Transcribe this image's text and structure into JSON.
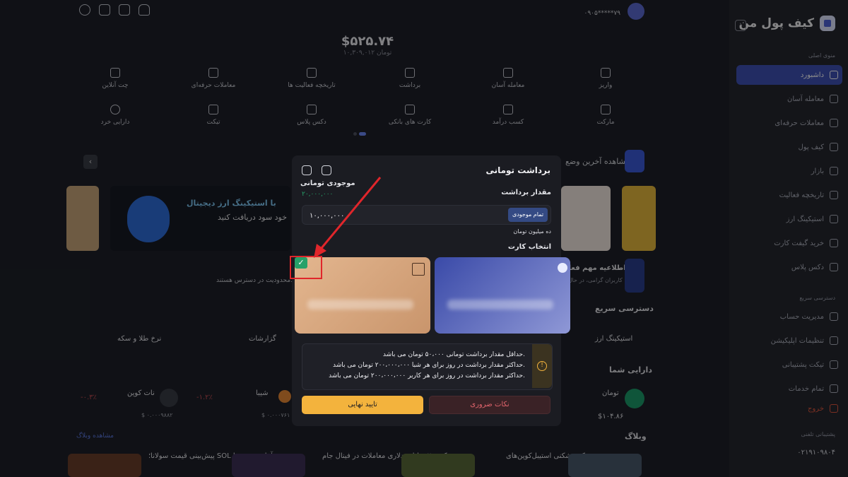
{
  "sidebar": {
    "logo": "کیف پول من",
    "section_main": "منوی اصلی",
    "items": [
      {
        "label": "داشبورد"
      },
      {
        "label": "معامله آسان"
      },
      {
        "label": "معاملات حرفه‌ای"
      },
      {
        "label": "کیف پول"
      },
      {
        "label": "بازار"
      },
      {
        "label": "تاریخچه فعالیت"
      },
      {
        "label": "استیکینگ ارز"
      },
      {
        "label": "خرید گیفت کارت"
      },
      {
        "label": "دکس پلاس"
      }
    ],
    "section_quick": "دسترسی سریع",
    "quick_items": [
      {
        "label": "مدیریت حساب"
      },
      {
        "label": "تنظیمات اپلیکیشن"
      },
      {
        "label": "تیکت پشتیبانی"
      },
      {
        "label": "تمام خدمات"
      },
      {
        "label": "خروج"
      }
    ],
    "support_label": "پشتیبانی تلفنی",
    "support_phone": "۰۲۱۹۱۰۹۸۰۴"
  },
  "header": {
    "phone": "۰۹۰۵*****۷۹",
    "balance_usd": "$۵۲۵.۷۴",
    "balance_irt": "۱۰,۳۰۹,۰۱۲ تومان"
  },
  "quick_actions": [
    {
      "label": "واریز"
    },
    {
      "label": "معامله آسان"
    },
    {
      "label": "برداشت"
    },
    {
      "label": "تاریخچه فعالیت ها"
    },
    {
      "label": "معاملات حرفه‌ای"
    },
    {
      "label": "چت آنلاین"
    },
    {
      "label": "مارکت"
    },
    {
      "label": "کسب درآمد"
    },
    {
      "label": "کارت های بانکی"
    },
    {
      "label": "دکس پلاس"
    },
    {
      "label": "تیکت"
    },
    {
      "label": "دارایی خرد"
    }
  ],
  "background": {
    "recent_title": "مشاهده آخرین وضع",
    "banner_text": "با استیکینگ ارز دیجیتال",
    "banner_sub": "خود سود دریافت کنید",
    "notice": "اطلاعیه مهم فعال",
    "notice_sub": "کاربران گرامی، در حال ح",
    "limit_text": "محدودیت در دسترس هستند.",
    "quick_title": "دسترسی سریع",
    "staking_title": "استیکینگ ارز",
    "reports_title": "گزارشات",
    "gold_title": "نرخ طلا و سکه",
    "assets_title": "دارایی شما",
    "blog_title": "وبلاگ",
    "blog_link": "مشاهده وبلاگ",
    "assets": [
      {
        "name": "تومان",
        "sym": "IRT",
        "val": "$۱۰۴.۸۶"
      },
      {
        "name": "شیبا",
        "sym": "SHIB",
        "val": "$ ۰.۰۰۰۷۶۱",
        "chg": "-۱.۲٪"
      },
      {
        "name": "نات کوین",
        "sym": "NOT",
        "val": "$ ۰.۰۰۰۹۸۸۲",
        "chg": "-۰.۳٪"
      }
    ],
    "blog": [
      {
        "title": "رکوردشکنی استیبل‌کوین‌های"
      },
      {
        "title": "رکورد ۲ میلیارد دلاری معاملات در فینال جام"
      },
      {
        "title": "پیش‌بینی قیمت سولانا؛ SOL آماده صعود تا"
      }
    ]
  },
  "modal": {
    "title": "برداشت تومانی",
    "balance_label": "موجودی تومانی",
    "balance_value": "۲۰,۰۰۰,۰۰۰",
    "amount_label": "مقدار برداشت",
    "amount_value": "۱۰,۰۰۰,۰۰۰",
    "all_button": "تمام موجودی",
    "amount_words": "ده میلیون تومان",
    "select_card": "انتخاب کارت",
    "notes": [
      "حداقل مقدار برداشت تومانی ۵۰،۰۰۰ تومان می باشد.",
      "حداکثر مقدار برداشت در روز برای هر شبا ۲۰۰،۰۰۰،۰۰۰ تومان می باشد.",
      "حداکثر مقدار برداشت در روز برای هر کاربر ۲۰۰،۰۰۰،۰۰۰ تومان می باشد."
    ],
    "confirm": "تایید نهایی",
    "important": "نکات ضروری"
  },
  "colors": {
    "accent": "#3f51b5",
    "yellow": "#f3b33d",
    "green": "#26a169",
    "red": "#e0262b"
  }
}
